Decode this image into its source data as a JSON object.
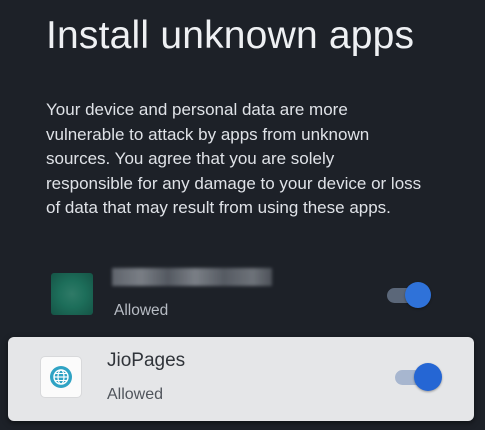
{
  "header": {
    "title": "Install unknown apps"
  },
  "warning": {
    "text": "Your device and personal data are more vulnerable to attack by apps from unknown sources. You agree that you are solely responsible for any damage to your device or loss of data that may result from using these apps."
  },
  "apps": [
    {
      "name": "",
      "status": "Allowed",
      "enabled": true,
      "focused": false,
      "icon": "obscured-app-icon"
    },
    {
      "name": "JioPages",
      "status": "Allowed",
      "enabled": true,
      "focused": true,
      "icon": "globe-icon"
    }
  ],
  "colors": {
    "background": "#1d2128",
    "toggle_on": "#2f72d9",
    "focused_row": "#e5e6e8"
  }
}
